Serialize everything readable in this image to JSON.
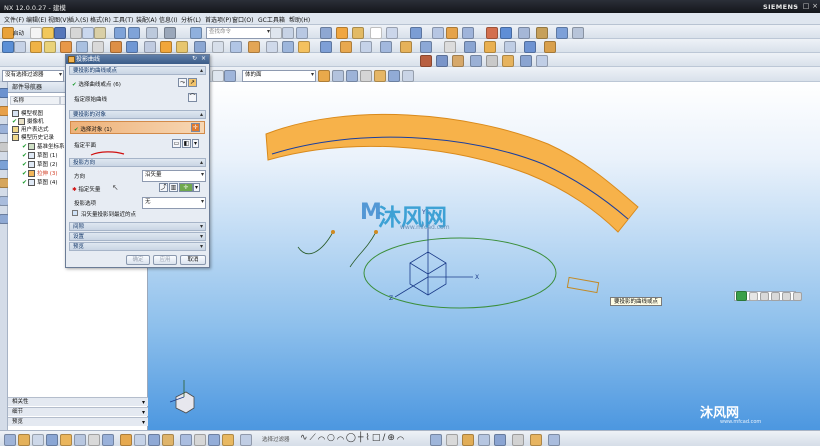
{
  "titlebar": {
    "title": "NX 12.0.0.27 - 建模",
    "brand": "SIEMENS",
    "controls": [
      "–",
      "□",
      "×"
    ]
  },
  "menubar": {
    "items": [
      "文件(F)",
      "编辑(E)",
      "视图(V)",
      "插入(S)",
      "格式(R)",
      "工具(T)",
      "装配(A)",
      "信息(I)",
      "分析(L)",
      "首选项(P)",
      "窗口(O)",
      "GC工具箱",
      "帮助(H)"
    ]
  },
  "toolbar": {
    "start_label": "启动",
    "search_placeholder": "查找命令",
    "filter_value": "没有选择过滤器",
    "scope_value": "体的面"
  },
  "navigator": {
    "title": "部件导航器",
    "col_name": "名称",
    "tree": [
      {
        "label": "模型视图",
        "indent": 0
      },
      {
        "label": "摄像机",
        "indent": 0
      },
      {
        "label": "用户表达式",
        "indent": 0
      },
      {
        "label": "模型历史记录",
        "indent": 0
      },
      {
        "label": "基准坐标系",
        "indent": 1
      },
      {
        "label": "草图 (1)",
        "indent": 1
      },
      {
        "label": "草图 (2)",
        "indent": 1
      },
      {
        "label": "拉伸 (3)",
        "indent": 1
      },
      {
        "label": "草图 (4)",
        "indent": 1
      }
    ],
    "bottom_panels": [
      "相关性",
      "细节",
      "预览"
    ]
  },
  "dialog": {
    "title": "投影曲线",
    "sections": {
      "curves": "要投影的曲线或点",
      "target": "要投影的对象",
      "direction": "投影方向",
      "gap": "间隙",
      "settings": "设置",
      "preview": "预览"
    },
    "select_curve": "选择曲线或点 (6)",
    "specify_origin_curve": "指定原始曲线",
    "select_object": "选择对象 (1)",
    "specify_plane": "指定平面",
    "direction_label": "方向",
    "direction_value": "沿矢量",
    "specify_vector": "指定矢量",
    "projection_option_label": "投影选项",
    "projection_option_value": "无",
    "project_to_nearest": "沿矢量投影到最近的点",
    "ok": "确定",
    "apply": "应用",
    "cancel": "取消"
  },
  "tooltip": "要投影的曲线或点",
  "viewport": {
    "axis_labels": [
      "Y",
      "X",
      "Z"
    ]
  },
  "status": {
    "snap_label": "选择过滤器"
  },
  "watermark": {
    "main": "沐风网",
    "url": "www.mfcad.com",
    "corner": "沐风网",
    "corner_url": "www.mfcad.com"
  },
  "colors": {
    "surface": "#f7b24a",
    "surface_edge": "#d98a1c",
    "curve": "#1a3fa0",
    "accent_orange": "#e07a2e",
    "underline_red": "#d01010"
  }
}
